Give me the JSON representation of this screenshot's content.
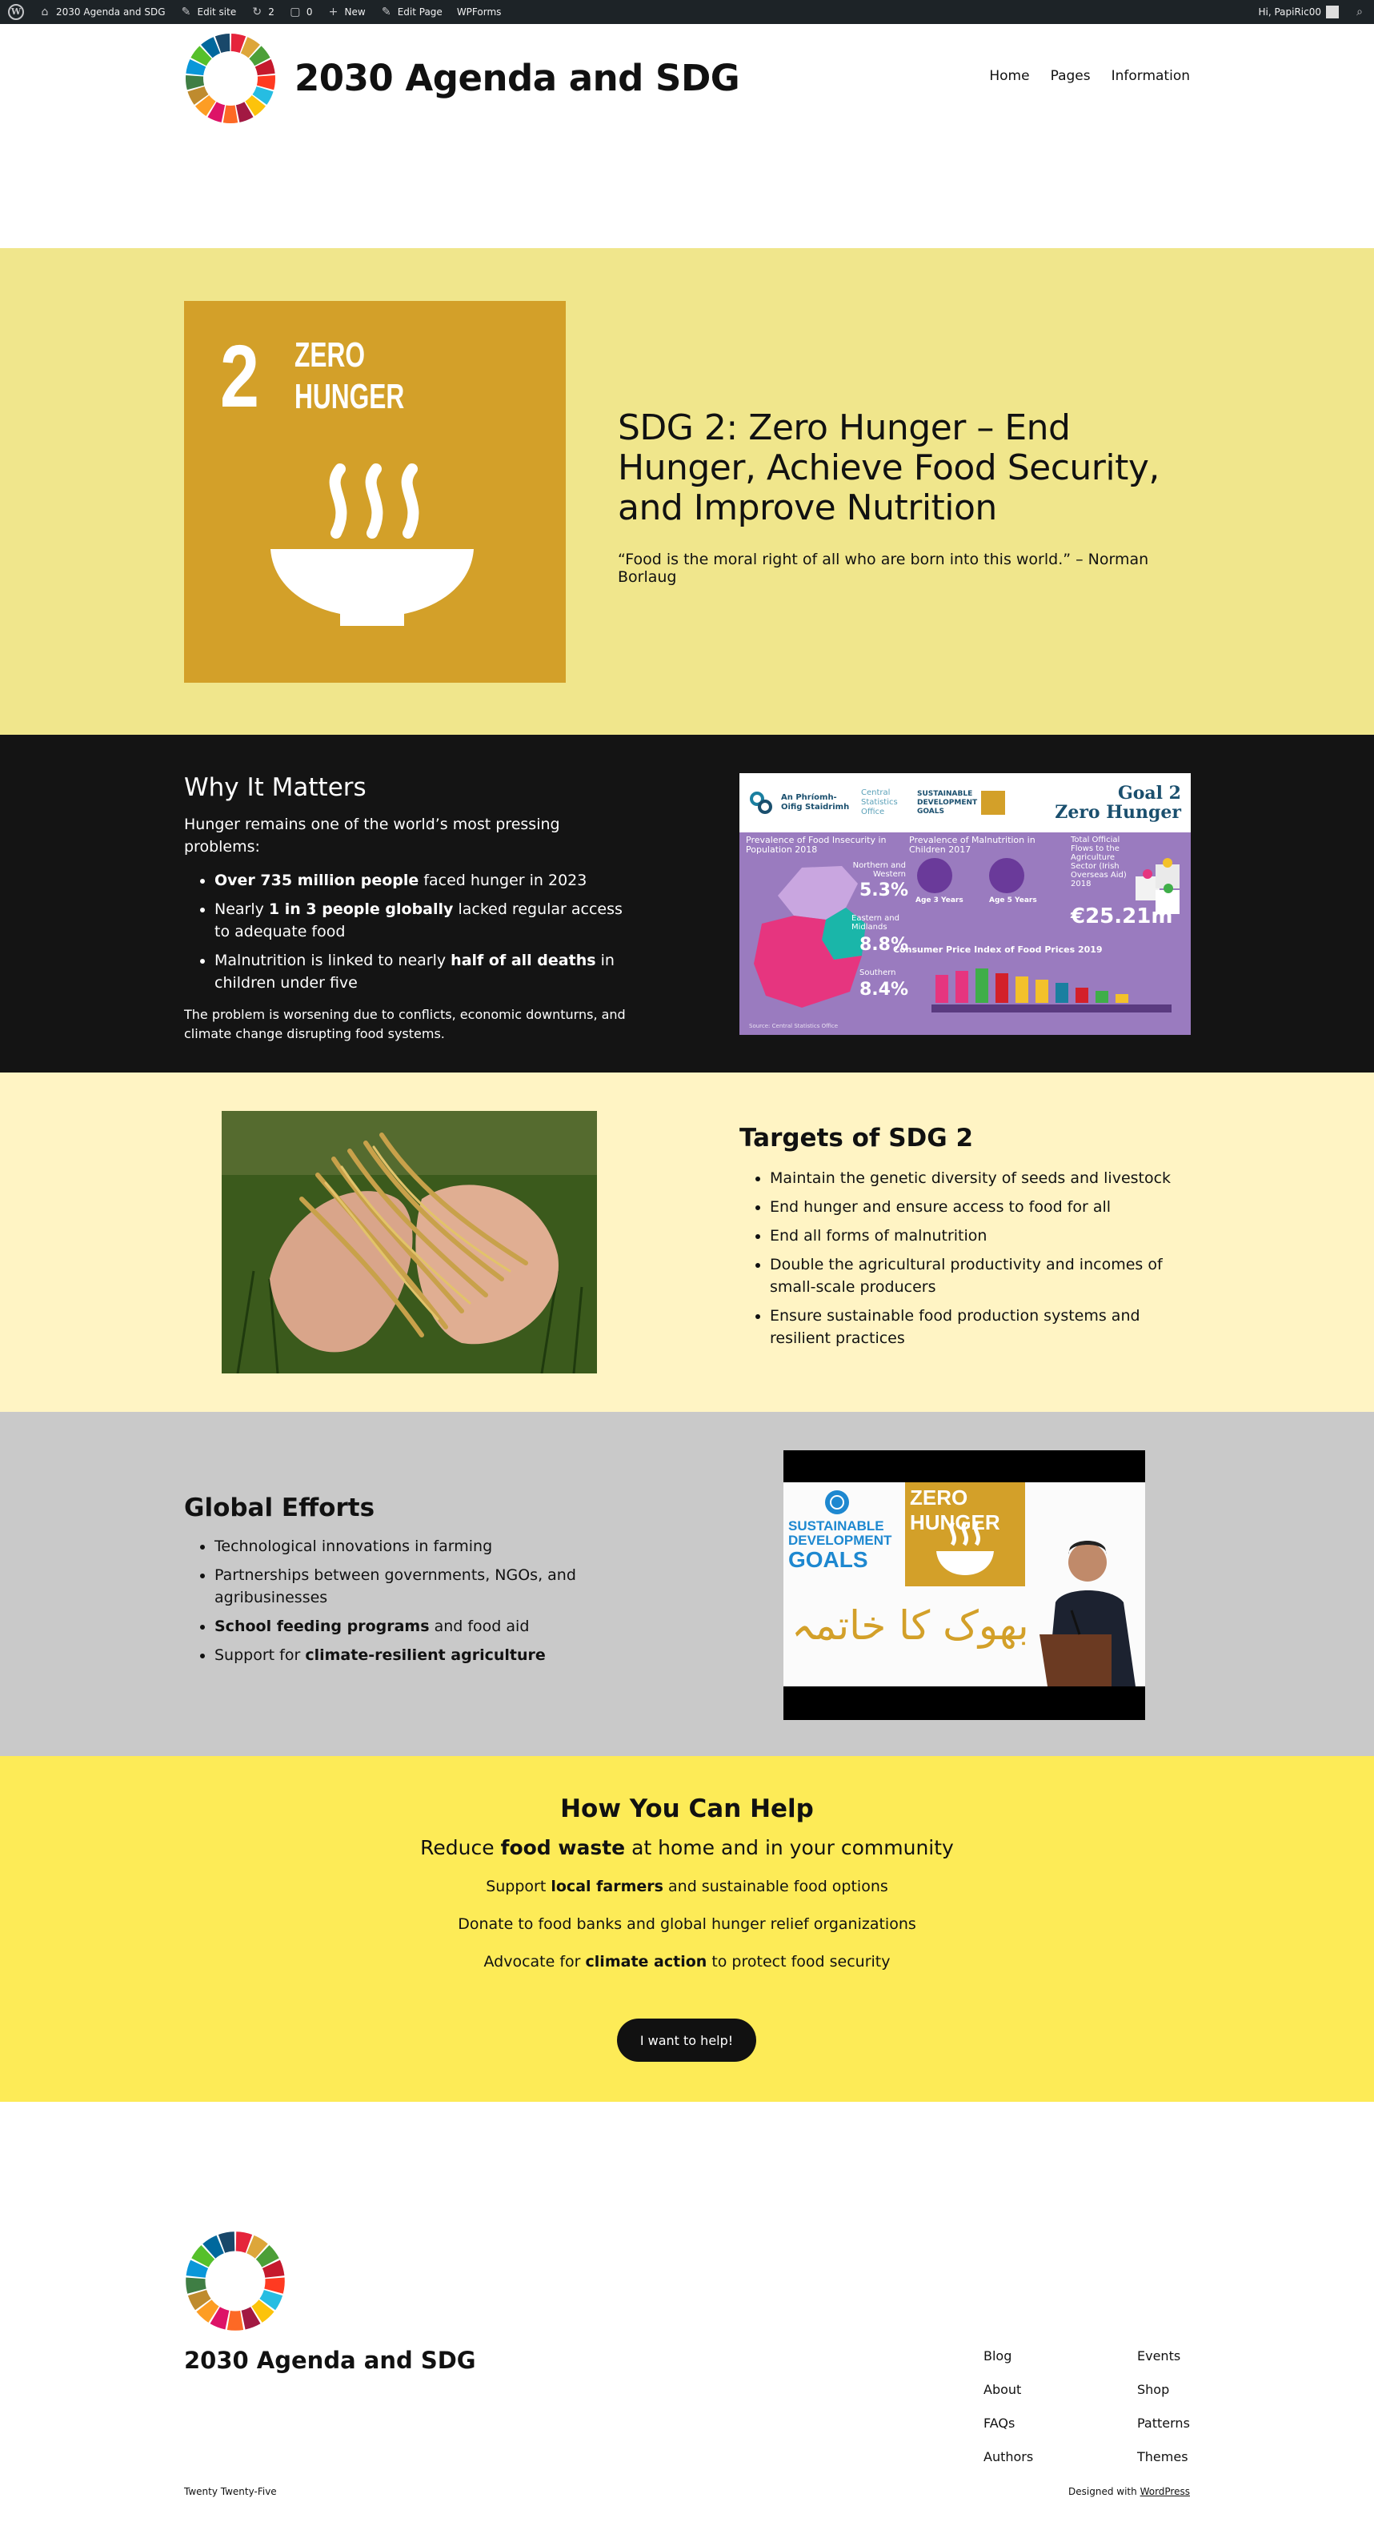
{
  "admin_bar": {
    "site": "2030 Agenda and SDG",
    "edit_site": "Edit site",
    "updates": "2",
    "comments": "0",
    "new": "New",
    "edit_page": "Edit Page",
    "wpforms": "WPForms",
    "greeting": "Hi, PapiRic00"
  },
  "header": {
    "site_title": "2030 Agenda and SDG",
    "nav": [
      "Home",
      "Pages",
      "Information"
    ]
  },
  "hero": {
    "tile_number": "2",
    "tile_line1": "ZERO",
    "tile_line2": "HUNGER",
    "tile_color": "#d3a029",
    "title": "SDG 2: Zero Hunger – End Hunger, Achieve Food Security, and Improve Nutrition",
    "quote": "“Food is the moral right of all who are born into this world.” – Norman Borlaug"
  },
  "why": {
    "heading": "Why It Matters",
    "intro": "Hunger remains one of the world’s most pressing problems:",
    "b1_bold": "Over 735 million people",
    "b1_rest": " faced hunger in 2023",
    "b2_pre": "Nearly ",
    "b2_bold": "1 in 3 people globally",
    "b2_rest": " lacked regular access to adequate food",
    "b3_pre": "Malnutrition is linked to nearly ",
    "b3_bold": "half of all deaths",
    "b3_rest": " in children under five",
    "closing": "The problem is worsening due to conflicts, economic downturns, and climate change disrupting food systems.",
    "infographic": {
      "org1": "An Phríomh-Oifig Staidrimh",
      "org2": "Central Statistics Office",
      "sdg_logo": "SUSTAINABLE DEVELOPMENT GOALS",
      "goal_line1": "Goal 2",
      "goal_line2": "Zero Hunger",
      "panel1": "Prevalence of Food Insecurity in Population 2018",
      "panel2": "Prevalence of Malnutrition in Children 2017",
      "panel3": "Total Official Flows to the Agriculture Sector (Irish Overseas Aid) 2018",
      "r1": "Northern and Western",
      "v1": "5.3%",
      "r2": "Eastern and Midlands",
      "v2": "8.8%",
      "r3": "Southern",
      "v3": "8.4%",
      "age3": "Age 3 Years",
      "age5": "Age 5 Years",
      "flow": "€25.21m",
      "cpi": "Consumer Price Index of Food Prices 2019",
      "source": "Source: Central Statistics Office"
    }
  },
  "targets": {
    "heading": "Targets of SDG 2",
    "items": [
      "Maintain the genetic diversity of seeds and livestock",
      "End hunger and ensure access to food for all",
      "End all forms of malnutrition",
      "Double the agricultural productivity and incomes of small-scale producers",
      "Ensure sustainable food production systems and resilient practices"
    ]
  },
  "global": {
    "heading": "Global Efforts",
    "i1": "Technological innovations in farming",
    "i2": "Partnerships between governments, NGOs, and agribusinesses",
    "i3_bold": "School feeding programs",
    "i3_rest": " and food aid",
    "i4_pre": "Support for ",
    "i4_bold": "climate-resilient agriculture",
    "video": {
      "logo_line1": "SUSTAINABLE",
      "logo_line2": "DEVELOPMENT",
      "logo_line3": "GOALS",
      "tile": "ZERO HUNGER",
      "urdu": "بھوک کا خاتمہ"
    }
  },
  "help": {
    "heading": "How You Can Help",
    "lead_pre": "Reduce ",
    "lead_bold": "food waste",
    "lead_rest": " at home and in your community",
    "l1_pre": "Support ",
    "l1_bold": "local farmers",
    "l1_rest": " and sustainable food options",
    "l2": "Donate to food banks and global hunger relief organizations",
    "l3_pre": "Advocate for ",
    "l3_bold": "climate action",
    "l3_rest": " to protect food security",
    "button": "I want to help!"
  },
  "footer": {
    "title": "2030 Agenda and SDG",
    "links_col1": [
      "Blog",
      "About",
      "FAQs",
      "Authors"
    ],
    "links_col2": [
      "Events",
      "Shop",
      "Patterns",
      "Themes"
    ],
    "theme": "Twenty Twenty-Five",
    "designed_pre": "Designed with ",
    "designed_link": "WordPress"
  }
}
